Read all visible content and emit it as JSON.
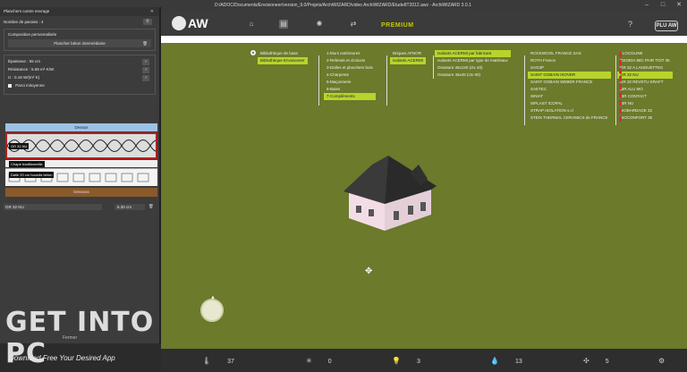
{
  "window": {
    "title": "D:/ADOC/Documents/Envisioneer/version_9.0/Projets/ArchiWIZARD/video ArchiWIZARD/Etude8T2012.awz - ArchiWIZARD 3.0.1"
  },
  "panel": {
    "header": "Planchers contre envrage",
    "floors_label": "Nombre de paroies : 4",
    "composition_label": "Composition personnalisée",
    "element_name": "Plancher béton intermédiaire",
    "thickness": "Épaisseur : 55 cm",
    "resistance": "Résistance : 5.69 m²·K/W",
    "u_value": "U : 0.18 W/(m²·K)",
    "mitoyen_label": "Paroi mitoyenne",
    "top_label": "Dessus",
    "bottom_label": "Dessous",
    "layers": [
      {
        "label": "GR 32 NU"
      },
      {
        "label": "Chape traditionnelle"
      },
      {
        "label": "Dalle 20 cm hourdis béton"
      }
    ],
    "select_value": "GR 32 NU",
    "select_thickness": "6.30 cm",
    "footer_button": "Fermer"
  },
  "toolbar": {
    "brand": "AW",
    "premium_label": "PREMIUM",
    "help": "?",
    "plus_button": "PLU AW"
  },
  "menus": {
    "root": {
      "label": "Bibliothèque de base",
      "selected": "Bibliothèque Envisioneer"
    },
    "level1": [
      "1-Murs extérieures",
      "2-Refends et cloisons",
      "3-Dalles et planchers bois",
      "4-Charpente",
      "5-Maçonnerie",
      "6-Baies",
      "7-Compléments"
    ],
    "level1_selected": 6,
    "level2": [
      "Briques AFNOR",
      "Isolants ACERMI"
    ],
    "level2_selected": 1,
    "level3": [
      "Isolants ACERMI par fabricant",
      "Isolants ACERMI par type de matériaux",
      "Ossature 45x120 (ctx 40)",
      "Ossature 45x45 (ctx 60)"
    ],
    "level3_selected": 0,
    "level4": [
      "ROCKWOOL FRANCE SAS",
      "ROTH France",
      "SAG3P",
      "SAINT GOBAIN ISOVER",
      "SAINT GOBAIN WEBER FRANCE",
      "SAETEC",
      "SINIAT",
      "SIPLAST ICOPAL",
      "STRAP ISOLATION s.r.l",
      "STEIX THERMAL CERAMICS de FRANCE"
    ],
    "level4_selected": 3,
    "level5": [
      "FLOCOLINE",
      "GEOIDA 88C PAIR TOIT 35",
      "GR 32 A LANGUETTES",
      "GR 32 NU",
      "GR 32 REVETU KRAFT",
      "IBR ALU MO",
      "IBR CONTACT",
      "IBR NU",
      "ISOBARDAGE 32",
      "ISOCONFORT 35"
    ],
    "level5_selected": 3
  },
  "statusbar": {
    "temperature": "37",
    "sun": "0",
    "light": "3",
    "drops": "13",
    "wind": "5"
  },
  "watermark": {
    "text": "GET INTO PC",
    "sub": "Download Free Your Desired App"
  },
  "colors": {
    "viewport_bg": "#6b7a2b",
    "menu_highlight": "#b8d42b",
    "premium": "#c8c800",
    "top_layer": "#9cc3e6",
    "bottom_layer": "#8a5a2b"
  }
}
